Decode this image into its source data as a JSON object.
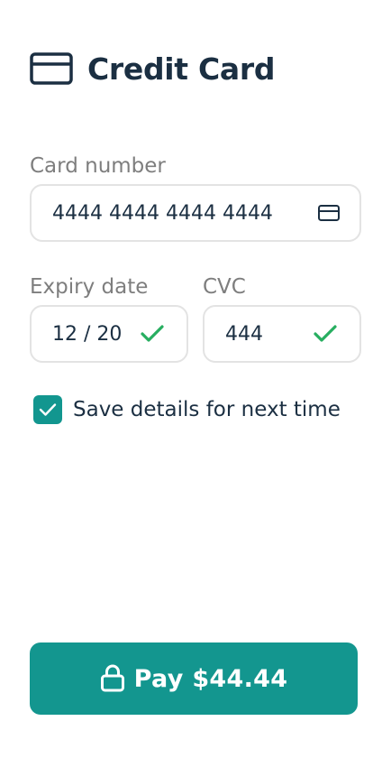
{
  "header": {
    "title": "Credit Card",
    "icon": "credit-card-icon"
  },
  "card_number": {
    "label": "Card number",
    "value": "4444 4444 4444 4444",
    "icon": "credit-card-icon"
  },
  "expiry": {
    "label": "Expiry date",
    "value": "12 / 20",
    "icon": "check-icon"
  },
  "cvc": {
    "label": "CVC",
    "value": "444",
    "icon": "check-icon"
  },
  "save_details": {
    "label": "Save details for next time",
    "checked": true
  },
  "pay_button": {
    "label": "Pay $44.44",
    "icon": "lock-icon"
  },
  "colors": {
    "primary": "#13968f",
    "text": "#1b2f42",
    "label": "#7e7e7e",
    "success": "#27ae60",
    "border": "#e3e3e3"
  }
}
